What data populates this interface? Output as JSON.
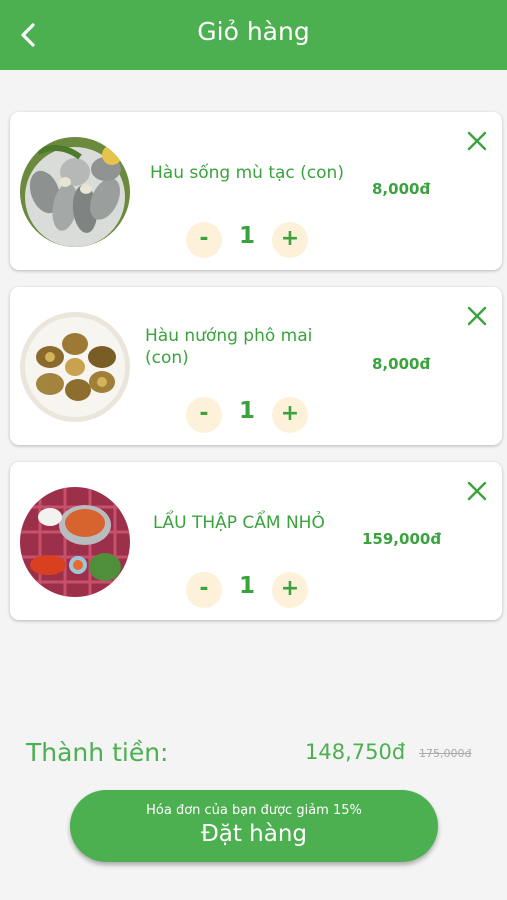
{
  "header": {
    "title": "Giỏ hàng"
  },
  "cart": {
    "items": [
      {
        "name": "Hàu sống mù tạc (con)",
        "price": "8,000đ",
        "qty": "1",
        "minus": "-",
        "plus": "+"
      },
      {
        "name": "Hàu nướng phô mai (con)",
        "price": "8,000đ",
        "qty": "1",
        "minus": "-",
        "plus": "+"
      },
      {
        "name": "LẨU THẬP CẨM NHỎ",
        "price": "159,000đ",
        "qty": "1",
        "minus": "-",
        "plus": "+"
      }
    ]
  },
  "summary": {
    "total_label": "Thành tiền:",
    "total_value": "148,750đ",
    "original_total": "175,000đ"
  },
  "order_button": {
    "discount_note": "Hóa đơn của bạn được giảm 15%",
    "label": "Đặt hàng"
  },
  "colors": {
    "primary": "#4caf50",
    "accent_text": "#3aa33d",
    "qty_button_bg": "#fdf1da"
  },
  "icons": {
    "back": "chevron-left-icon",
    "remove": "close-icon"
  }
}
